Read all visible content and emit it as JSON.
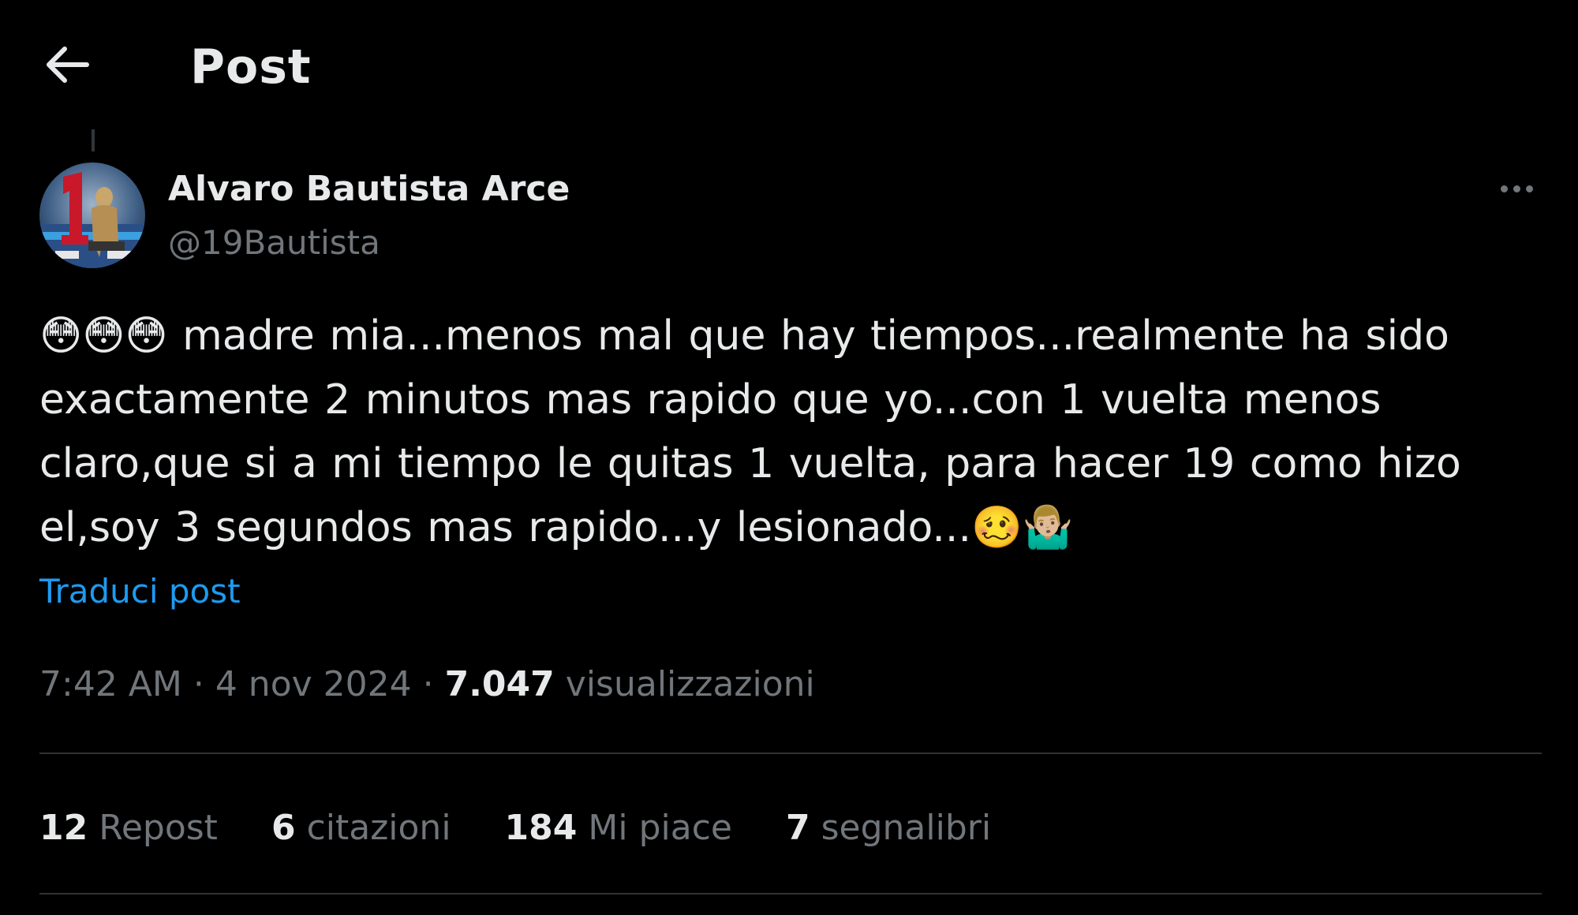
{
  "header": {
    "title": "Post",
    "back_icon": "arrow-left-icon"
  },
  "author": {
    "name": "Alvaro Bautista Arce",
    "handle": "@19Bautista",
    "avatar_icon": "avatar-image"
  },
  "post": {
    "text": "😳😳😳 madre mia...menos mal que hay tiempos...realmente ha sido exactamente 2 minutos mas rapido que yo...con 1 vuelta menos claro,que si a mi tiempo le quitas 1 vuelta, para hacer 19 como hizo el,soy 3 segundos mas rapido...y lesionado...🥴🤷🏼‍♂️",
    "translate_label": "Traduci post"
  },
  "meta": {
    "time": "7:42 AM",
    "sep1": " · ",
    "date": "4 nov 2024",
    "sep2": " · ",
    "views": "7.047",
    "views_label": "visualizzazioni"
  },
  "stats": {
    "reposts": "12",
    "reposts_label": "Repost",
    "quotes": "6",
    "quotes_label": "citazioni",
    "likes": "184",
    "likes_label": "Mi piace",
    "bookmarks": "7",
    "bookmarks_label": "segnalibri"
  },
  "colors": {
    "background": "#000000",
    "text": "#e7e9ea",
    "secondary": "#71767b",
    "link": "#1d9bf0",
    "divider": "#2f3336"
  }
}
